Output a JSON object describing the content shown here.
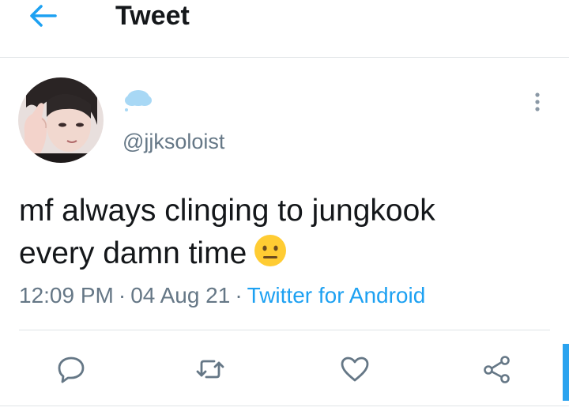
{
  "header": {
    "title": "Tweet",
    "back_icon": "arrow-left-icon",
    "accent": "#1da1f2"
  },
  "tweet": {
    "display_name_icon": "cloud-emoji",
    "handle": "@jjksoloist",
    "text_lines": [
      "mf always clinging to jungkook",
      "every damn time"
    ],
    "text_emoji": "neutral-face-emoji",
    "time": "12:09 PM",
    "date": "04 Aug 21",
    "separator": "·",
    "source": "Twitter for Android"
  },
  "actions": {
    "reply_icon": "reply-icon",
    "retweet_icon": "retweet-icon",
    "like_icon": "heart-icon",
    "share_icon": "share-icon"
  },
  "colors": {
    "text": "#14171a",
    "muted": "#657786",
    "link": "#1da1f2",
    "divider": "#dfe3e6"
  }
}
